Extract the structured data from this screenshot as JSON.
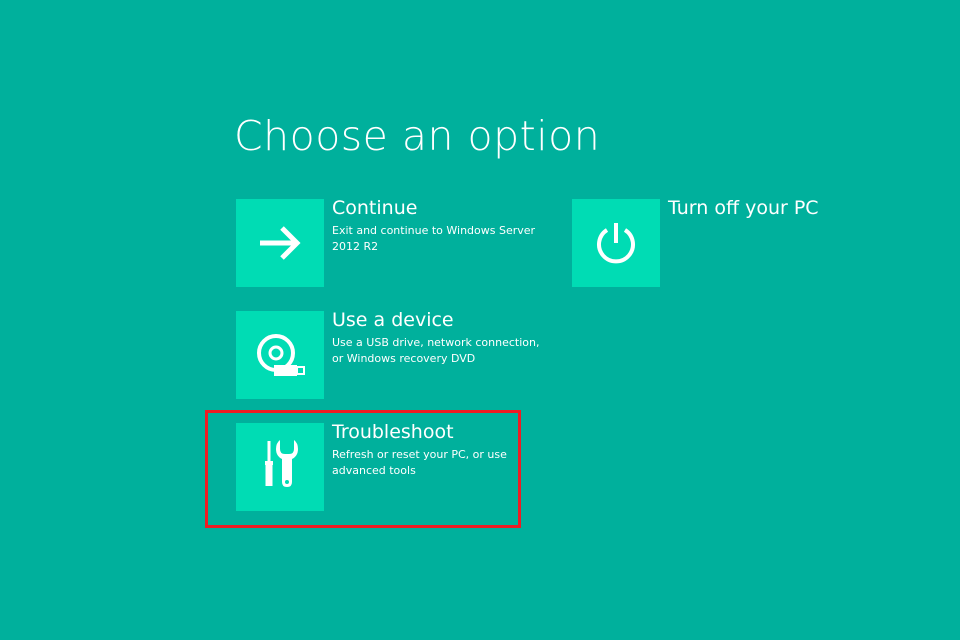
{
  "title": "Choose an option",
  "colors": {
    "background": "#00b09c",
    "tile": "#00dcb4",
    "text": "#ffffff",
    "highlight": "#ed1c24"
  },
  "options": [
    {
      "id": "continue",
      "title": "Continue",
      "description": "Exit and continue to Windows Server 2012 R2",
      "icon": "arrow-right-icon"
    },
    {
      "id": "use-device",
      "title": "Use a device",
      "description": "Use a USB drive, network connection, or Windows recovery DVD",
      "icon": "disc-usb-icon"
    },
    {
      "id": "troubleshoot",
      "title": "Troubleshoot",
      "description": "Refresh or reset your PC, or use advanced tools",
      "icon": "tools-icon",
      "highlighted": true
    },
    {
      "id": "turn-off",
      "title": "Turn off your PC",
      "description": "",
      "icon": "power-icon"
    }
  ]
}
